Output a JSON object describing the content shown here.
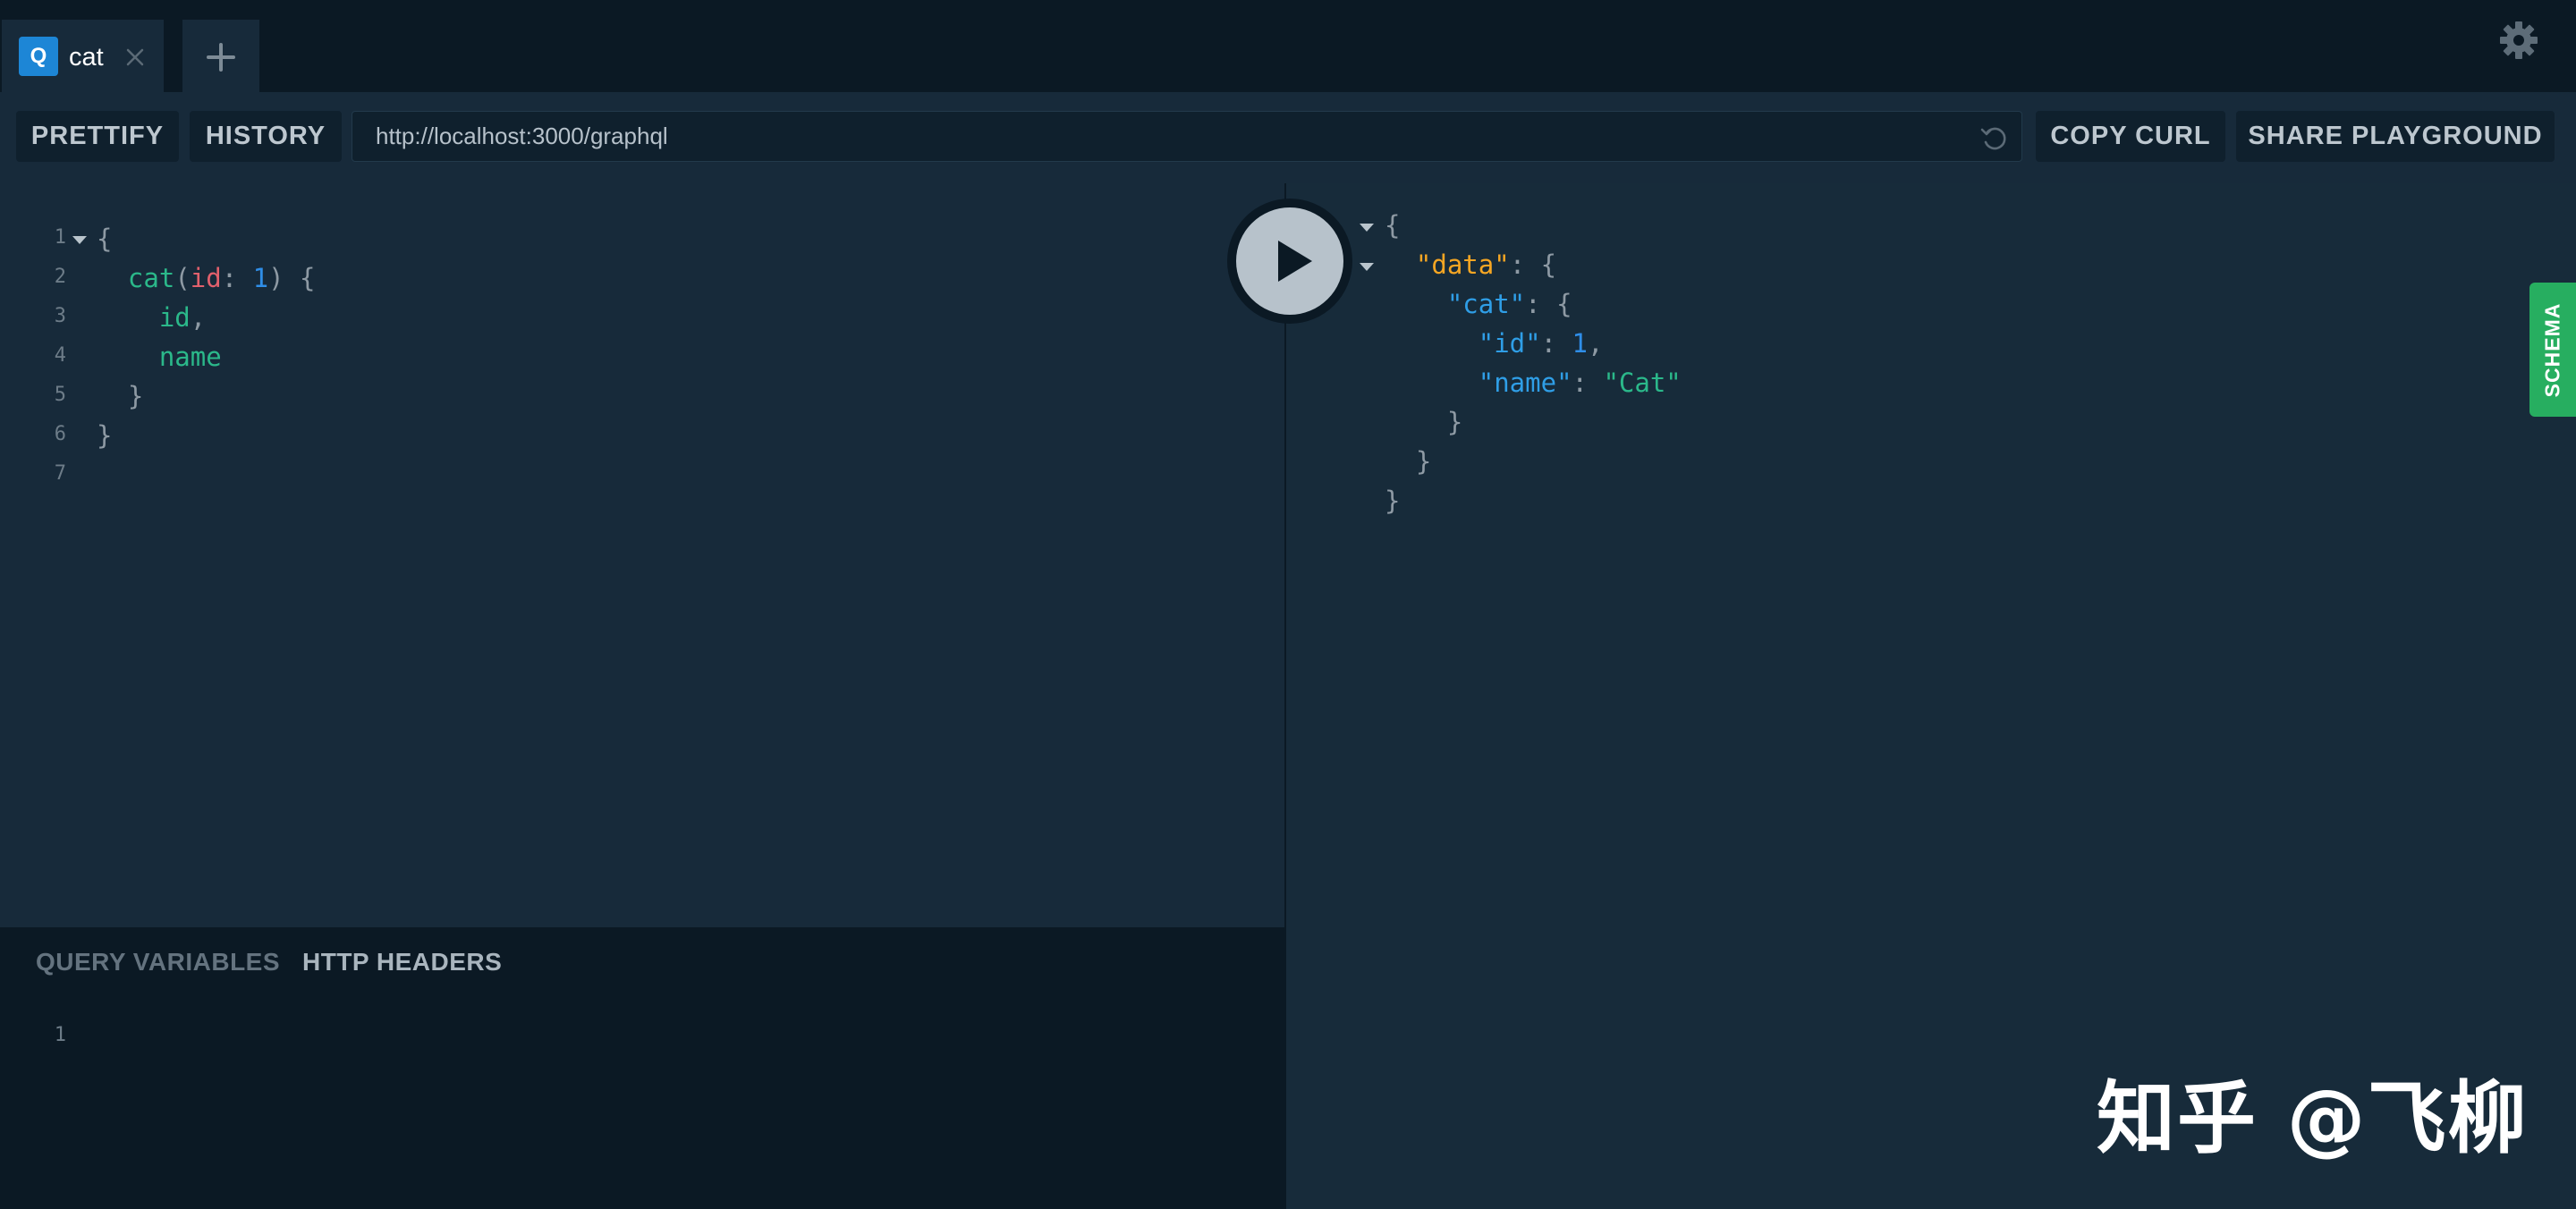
{
  "tabs": [
    {
      "badge": "Q",
      "title": "cat"
    }
  ],
  "add_tab_label": "+",
  "toolbar": {
    "prettify_label": "PRETTIFY",
    "history_label": "HISTORY",
    "endpoint_url": "http://localhost:3000/graphql",
    "copy_curl_label": "COPY CURL",
    "share_label": "SHARE PLAYGROUND"
  },
  "query_editor": {
    "line_numbers": [
      "1",
      "2",
      "3",
      "4",
      "5",
      "6",
      "7"
    ],
    "lines": [
      [
        {
          "t": "{",
          "k": "punc"
        }
      ],
      [
        {
          "t": "  cat",
          "k": "field"
        },
        {
          "t": "(",
          "k": "punc"
        },
        {
          "t": "id",
          "k": "arg"
        },
        {
          "t": ": ",
          "k": "punc"
        },
        {
          "t": "1",
          "k": "num"
        },
        {
          "t": ") {",
          "k": "punc"
        }
      ],
      [
        {
          "t": "    id",
          "k": "field"
        },
        {
          "t": ",",
          "k": "punc"
        }
      ],
      [
        {
          "t": "    name",
          "k": "field"
        }
      ],
      [
        {
          "t": "  }",
          "k": "punc"
        }
      ],
      [
        {
          "t": "}",
          "k": "punc"
        }
      ],
      []
    ]
  },
  "variables_panel": {
    "query_variables_label": "QUERY VARIABLES",
    "http_headers_label": "HTTP HEADERS",
    "line_numbers": [
      "1"
    ]
  },
  "result": {
    "lines": [
      [
        {
          "t": "{",
          "k": "punc"
        }
      ],
      [
        {
          "t": "  ",
          "k": "punc"
        },
        {
          "t": "\"data\"",
          "k": "key-data"
        },
        {
          "t": ": {",
          "k": "punc"
        }
      ],
      [
        {
          "t": "    ",
          "k": "punc"
        },
        {
          "t": "\"cat\"",
          "k": "key"
        },
        {
          "t": ": {",
          "k": "punc"
        }
      ],
      [
        {
          "t": "      ",
          "k": "punc"
        },
        {
          "t": "\"id\"",
          "k": "key"
        },
        {
          "t": ": ",
          "k": "punc"
        },
        {
          "t": "1",
          "k": "num"
        },
        {
          "t": ",",
          "k": "punc"
        }
      ],
      [
        {
          "t": "      ",
          "k": "punc"
        },
        {
          "t": "\"name\"",
          "k": "key"
        },
        {
          "t": ": ",
          "k": "punc"
        },
        {
          "t": "\"Cat\"",
          "k": "str"
        }
      ],
      [
        {
          "t": "    }",
          "k": "punc"
        }
      ],
      [
        {
          "t": "  }",
          "k": "punc"
        }
      ],
      [
        {
          "t": "}",
          "k": "punc"
        }
      ]
    ]
  },
  "schema_label": "SCHEMA",
  "watermark": "知乎 @飞柳",
  "icons": {
    "close": "close-icon",
    "add": "plus-icon",
    "settings": "gear-icon",
    "reload": "reload-icon",
    "run": "play-icon"
  },
  "colors": {
    "accent_blue": "#1d86d6",
    "schema_green": "#27ae60",
    "field_green": "#2bb88a",
    "arg_red": "#e1606c",
    "number_blue": "#2f8ee8",
    "data_orange": "#f5a623"
  }
}
